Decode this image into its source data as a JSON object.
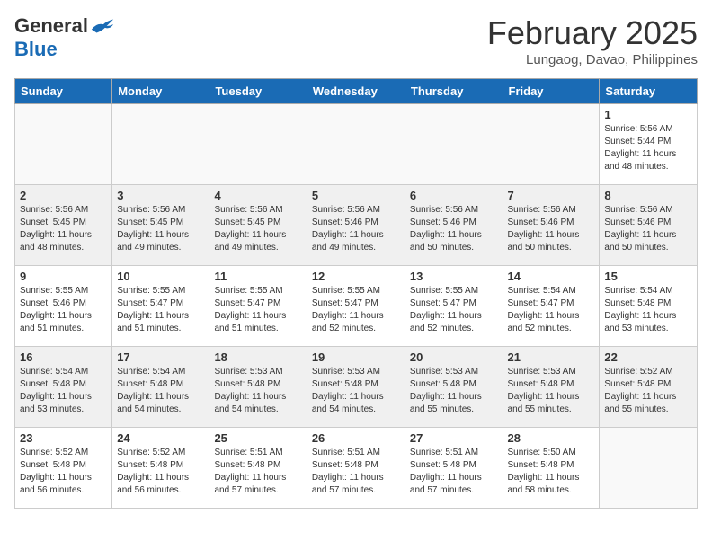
{
  "header": {
    "logo_general": "General",
    "logo_blue": "Blue",
    "month_title": "February 2025",
    "location": "Lungaog, Davao, Philippines"
  },
  "weekdays": [
    "Sunday",
    "Monday",
    "Tuesday",
    "Wednesday",
    "Thursday",
    "Friday",
    "Saturday"
  ],
  "weeks": [
    [
      {
        "day": "",
        "sunrise": "",
        "sunset": "",
        "daylight": "",
        "empty": true
      },
      {
        "day": "",
        "sunrise": "",
        "sunset": "",
        "daylight": "",
        "empty": true
      },
      {
        "day": "",
        "sunrise": "",
        "sunset": "",
        "daylight": "",
        "empty": true
      },
      {
        "day": "",
        "sunrise": "",
        "sunset": "",
        "daylight": "",
        "empty": true
      },
      {
        "day": "",
        "sunrise": "",
        "sunset": "",
        "daylight": "",
        "empty": true
      },
      {
        "day": "",
        "sunrise": "",
        "sunset": "",
        "daylight": "",
        "empty": true
      },
      {
        "day": "1",
        "sunrise": "Sunrise: 5:56 AM",
        "sunset": "Sunset: 5:44 PM",
        "daylight": "Daylight: 11 hours and 48 minutes.",
        "empty": false
      }
    ],
    [
      {
        "day": "2",
        "sunrise": "Sunrise: 5:56 AM",
        "sunset": "Sunset: 5:45 PM",
        "daylight": "Daylight: 11 hours and 48 minutes.",
        "empty": false
      },
      {
        "day": "3",
        "sunrise": "Sunrise: 5:56 AM",
        "sunset": "Sunset: 5:45 PM",
        "daylight": "Daylight: 11 hours and 49 minutes.",
        "empty": false
      },
      {
        "day": "4",
        "sunrise": "Sunrise: 5:56 AM",
        "sunset": "Sunset: 5:45 PM",
        "daylight": "Daylight: 11 hours and 49 minutes.",
        "empty": false
      },
      {
        "day": "5",
        "sunrise": "Sunrise: 5:56 AM",
        "sunset": "Sunset: 5:46 PM",
        "daylight": "Daylight: 11 hours and 49 minutes.",
        "empty": false
      },
      {
        "day": "6",
        "sunrise": "Sunrise: 5:56 AM",
        "sunset": "Sunset: 5:46 PM",
        "daylight": "Daylight: 11 hours and 50 minutes.",
        "empty": false
      },
      {
        "day": "7",
        "sunrise": "Sunrise: 5:56 AM",
        "sunset": "Sunset: 5:46 PM",
        "daylight": "Daylight: 11 hours and 50 minutes.",
        "empty": false
      },
      {
        "day": "8",
        "sunrise": "Sunrise: 5:56 AM",
        "sunset": "Sunset: 5:46 PM",
        "daylight": "Daylight: 11 hours and 50 minutes.",
        "empty": false
      }
    ],
    [
      {
        "day": "9",
        "sunrise": "Sunrise: 5:55 AM",
        "sunset": "Sunset: 5:46 PM",
        "daylight": "Daylight: 11 hours and 51 minutes.",
        "empty": false
      },
      {
        "day": "10",
        "sunrise": "Sunrise: 5:55 AM",
        "sunset": "Sunset: 5:47 PM",
        "daylight": "Daylight: 11 hours and 51 minutes.",
        "empty": false
      },
      {
        "day": "11",
        "sunrise": "Sunrise: 5:55 AM",
        "sunset": "Sunset: 5:47 PM",
        "daylight": "Daylight: 11 hours and 51 minutes.",
        "empty": false
      },
      {
        "day": "12",
        "sunrise": "Sunrise: 5:55 AM",
        "sunset": "Sunset: 5:47 PM",
        "daylight": "Daylight: 11 hours and 52 minutes.",
        "empty": false
      },
      {
        "day": "13",
        "sunrise": "Sunrise: 5:55 AM",
        "sunset": "Sunset: 5:47 PM",
        "daylight": "Daylight: 11 hours and 52 minutes.",
        "empty": false
      },
      {
        "day": "14",
        "sunrise": "Sunrise: 5:54 AM",
        "sunset": "Sunset: 5:47 PM",
        "daylight": "Daylight: 11 hours and 52 minutes.",
        "empty": false
      },
      {
        "day": "15",
        "sunrise": "Sunrise: 5:54 AM",
        "sunset": "Sunset: 5:48 PM",
        "daylight": "Daylight: 11 hours and 53 minutes.",
        "empty": false
      }
    ],
    [
      {
        "day": "16",
        "sunrise": "Sunrise: 5:54 AM",
        "sunset": "Sunset: 5:48 PM",
        "daylight": "Daylight: 11 hours and 53 minutes.",
        "empty": false
      },
      {
        "day": "17",
        "sunrise": "Sunrise: 5:54 AM",
        "sunset": "Sunset: 5:48 PM",
        "daylight": "Daylight: 11 hours and 54 minutes.",
        "empty": false
      },
      {
        "day": "18",
        "sunrise": "Sunrise: 5:53 AM",
        "sunset": "Sunset: 5:48 PM",
        "daylight": "Daylight: 11 hours and 54 minutes.",
        "empty": false
      },
      {
        "day": "19",
        "sunrise": "Sunrise: 5:53 AM",
        "sunset": "Sunset: 5:48 PM",
        "daylight": "Daylight: 11 hours and 54 minutes.",
        "empty": false
      },
      {
        "day": "20",
        "sunrise": "Sunrise: 5:53 AM",
        "sunset": "Sunset: 5:48 PM",
        "daylight": "Daylight: 11 hours and 55 minutes.",
        "empty": false
      },
      {
        "day": "21",
        "sunrise": "Sunrise: 5:53 AM",
        "sunset": "Sunset: 5:48 PM",
        "daylight": "Daylight: 11 hours and 55 minutes.",
        "empty": false
      },
      {
        "day": "22",
        "sunrise": "Sunrise: 5:52 AM",
        "sunset": "Sunset: 5:48 PM",
        "daylight": "Daylight: 11 hours and 55 minutes.",
        "empty": false
      }
    ],
    [
      {
        "day": "23",
        "sunrise": "Sunrise: 5:52 AM",
        "sunset": "Sunset: 5:48 PM",
        "daylight": "Daylight: 11 hours and 56 minutes.",
        "empty": false
      },
      {
        "day": "24",
        "sunrise": "Sunrise: 5:52 AM",
        "sunset": "Sunset: 5:48 PM",
        "daylight": "Daylight: 11 hours and 56 minutes.",
        "empty": false
      },
      {
        "day": "25",
        "sunrise": "Sunrise: 5:51 AM",
        "sunset": "Sunset: 5:48 PM",
        "daylight": "Daylight: 11 hours and 57 minutes.",
        "empty": false
      },
      {
        "day": "26",
        "sunrise": "Sunrise: 5:51 AM",
        "sunset": "Sunset: 5:48 PM",
        "daylight": "Daylight: 11 hours and 57 minutes.",
        "empty": false
      },
      {
        "day": "27",
        "sunrise": "Sunrise: 5:51 AM",
        "sunset": "Sunset: 5:48 PM",
        "daylight": "Daylight: 11 hours and 57 minutes.",
        "empty": false
      },
      {
        "day": "28",
        "sunrise": "Sunrise: 5:50 AM",
        "sunset": "Sunset: 5:48 PM",
        "daylight": "Daylight: 11 hours and 58 minutes.",
        "empty": false
      },
      {
        "day": "",
        "sunrise": "",
        "sunset": "",
        "daylight": "",
        "empty": true
      }
    ]
  ]
}
